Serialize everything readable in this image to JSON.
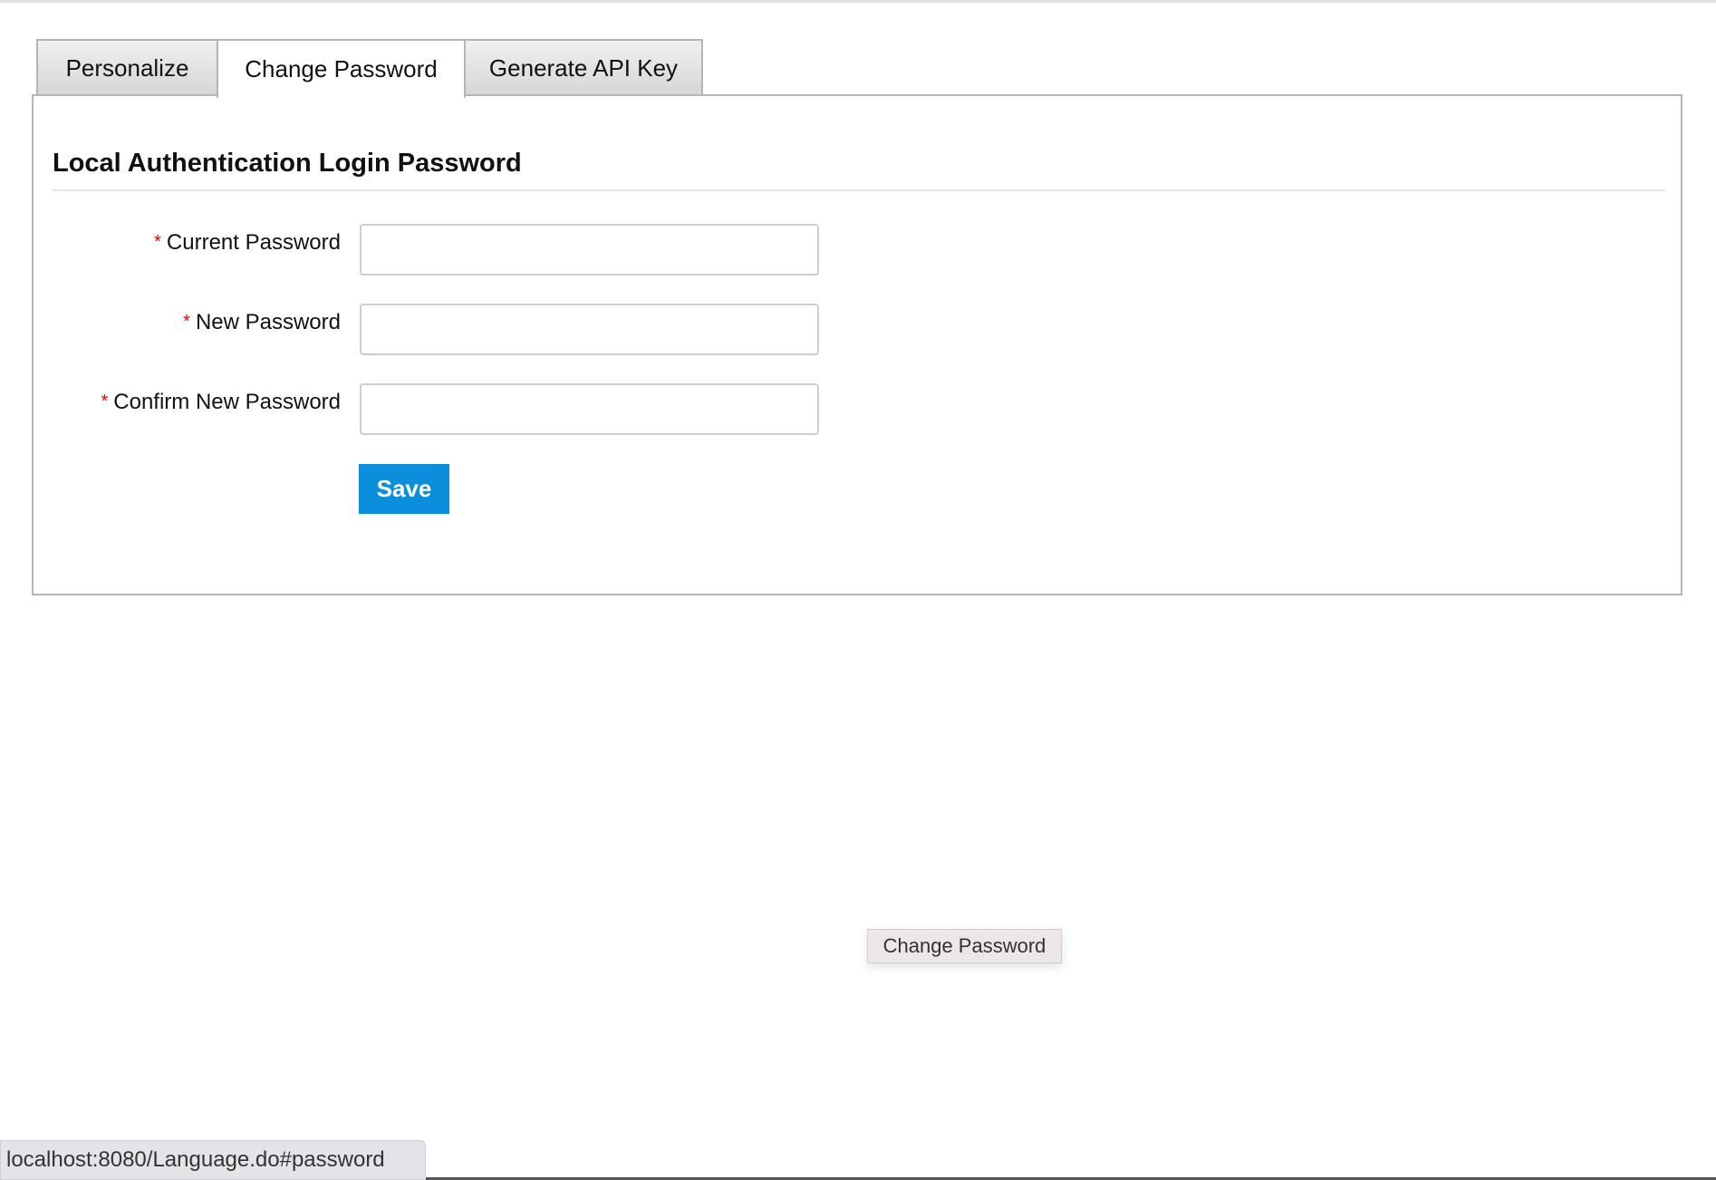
{
  "tabs": [
    {
      "label": "Personalize",
      "active": false
    },
    {
      "label": "Change Password",
      "active": true
    },
    {
      "label": "Generate API Key",
      "active": false
    }
  ],
  "section": {
    "title": "Local Authentication Login Password"
  },
  "form": {
    "required_marker": "*",
    "fields": [
      {
        "label": "Current Password",
        "value": ""
      },
      {
        "label": "New Password",
        "value": ""
      },
      {
        "label": "Confirm New Password",
        "value": ""
      }
    ],
    "save_label": "Save"
  },
  "tooltip": {
    "text": "Change Password"
  },
  "status_bar": {
    "url": "localhost:8080/Language.do#password"
  },
  "colors": {
    "accent": "#0b8fdc",
    "required": "#ee0000"
  }
}
